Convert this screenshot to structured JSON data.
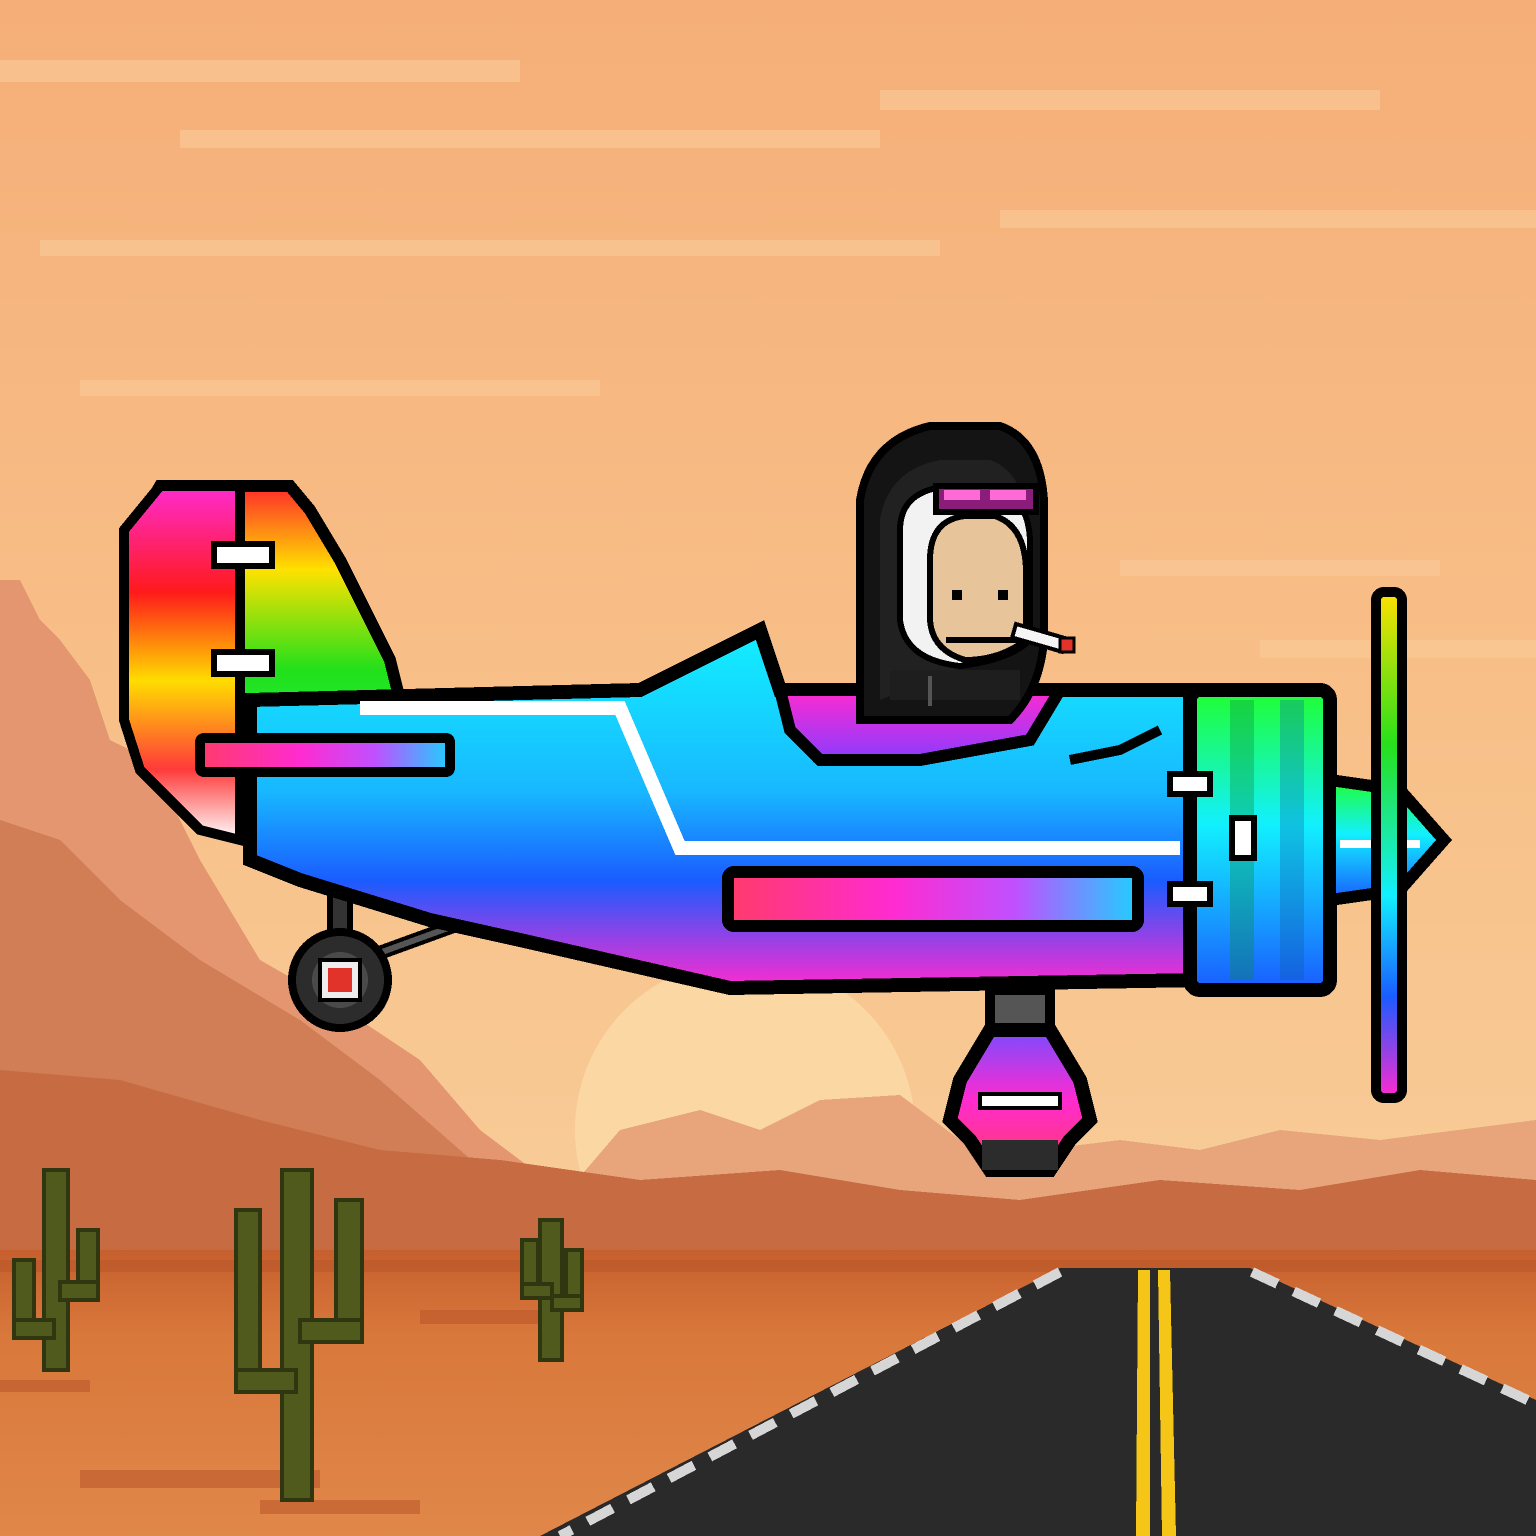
{
  "scene": {
    "setting": "desert-highway-sunset",
    "style": "pixel-art"
  },
  "colors": {
    "sky_top": "#f6b27a",
    "sky_mid": "#f8c08a",
    "sky_low": "#f7cf9c",
    "sun": "#fbd9a6",
    "far_mesa": "#e0946a",
    "near_mesa": "#c9714a",
    "ground": "#d9783b",
    "ground_dark": "#b8552a",
    "road": "#2a2a2a",
    "road_edge": "#d6d6d6",
    "center_line": "#f5c518",
    "cactus": "#4f5a1c",
    "plane_body_cyan": "#1ae6ff",
    "plane_body_blue": "#1b6bff",
    "plane_body_magenta": "#ff2bd0",
    "outline": "#0a0a0a"
  },
  "icons": {
    "pilot": "ape-pilot-icon",
    "plane": "biplane-icon",
    "propeller": "propeller-icon",
    "wheel": "wheel-icon",
    "cactus": "cactus-icon"
  }
}
